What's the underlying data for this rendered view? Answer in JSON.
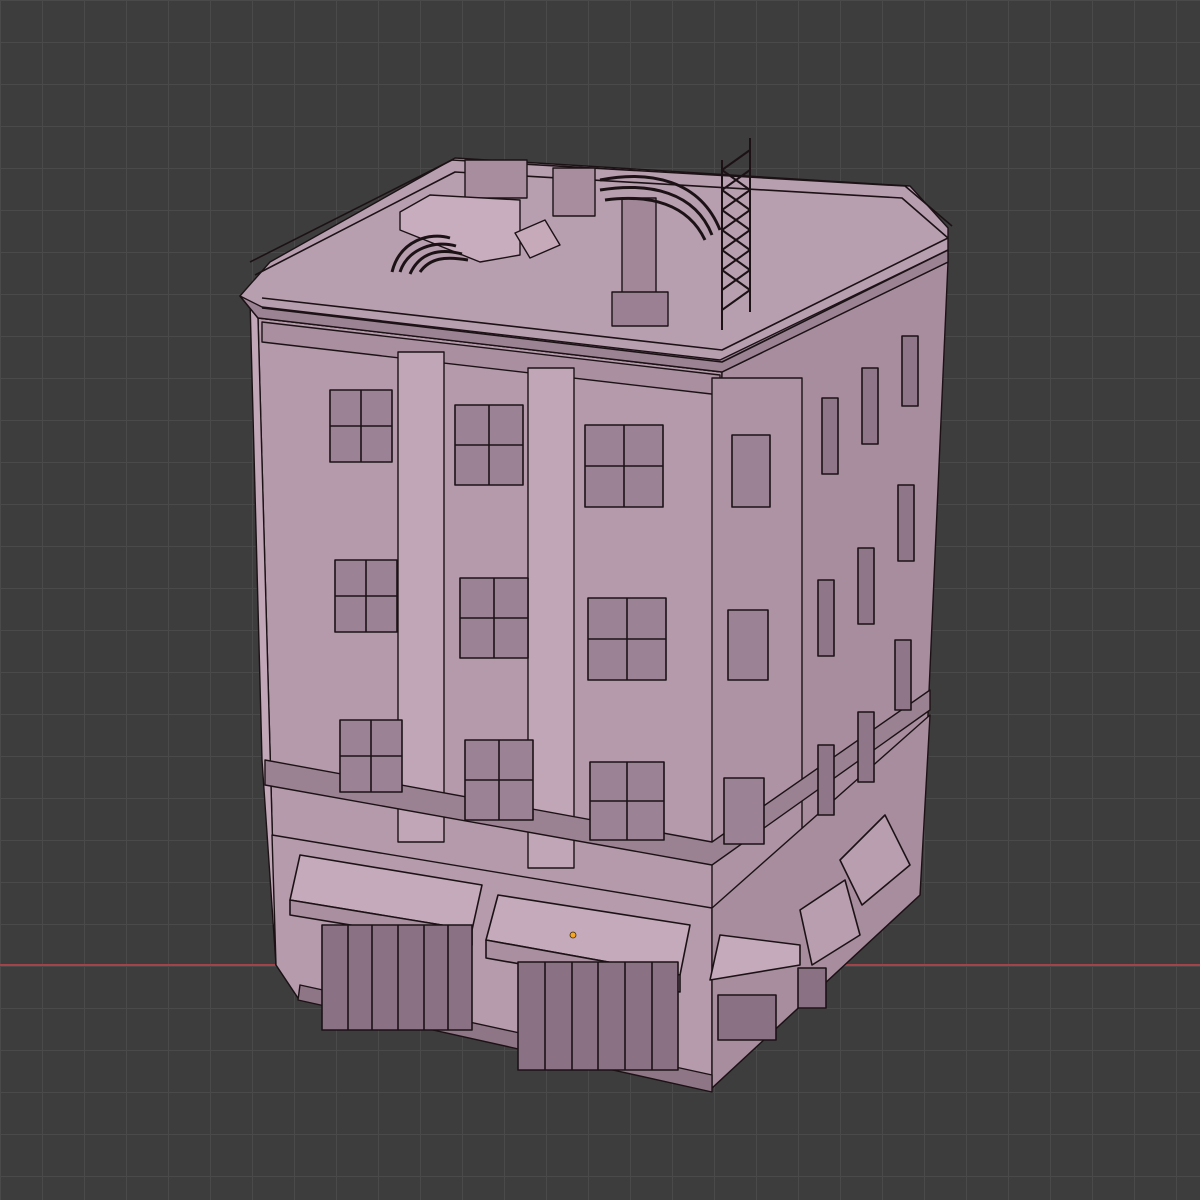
{
  "viewport": {
    "view": "3d-viewport",
    "shading_mode": "wireframe-overlay",
    "background_color": "#3d3d3d",
    "grid_color": "#4a4a4a",
    "x_axis_color": "#a3444a"
  },
  "object": {
    "type": "mesh",
    "subject": "building",
    "floors_upper": 3,
    "has_roof_railing": true,
    "has_awnings": true,
    "surface_color": "#b49aab",
    "surface_light": "#c7abbc",
    "surface_dark": "#9a8092",
    "edge_color": "#1c1216",
    "origin_color": "#f5a623"
  }
}
